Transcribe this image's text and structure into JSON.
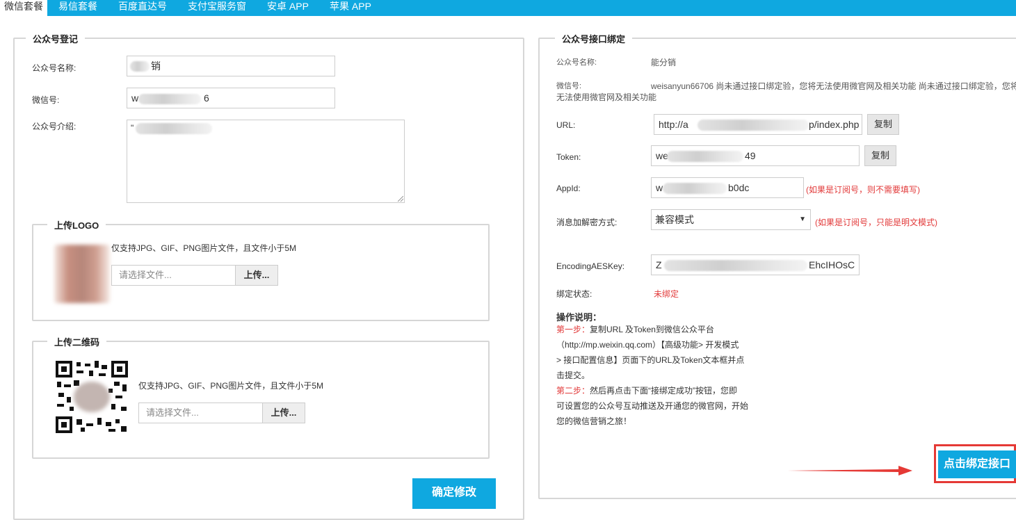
{
  "nav": {
    "tabs": [
      {
        "label": "微信套餐"
      },
      {
        "label": "易信套餐"
      },
      {
        "label": "百度直达号"
      },
      {
        "label": "支付宝服务窗"
      },
      {
        "label": "安卓 APP"
      },
      {
        "label": "苹果 APP"
      }
    ]
  },
  "left": {
    "legend": "公众号登记",
    "name_label": "公众号名称:",
    "name_value": "销",
    "wechat_label": "微信号:",
    "wechat_value_prefix": "w",
    "wechat_value_suffix": "6",
    "intro_label": "公众号介绍:",
    "intro_value": "\"",
    "logo": {
      "legend": "上传LOGO",
      "hint": "仅支持JPG、GIF、PNG图片文件，且文件小于5M",
      "placeholder": "请选择文件...",
      "button": "上传..."
    },
    "qr": {
      "legend": "上传二维码",
      "hint": "仅支持JPG、GIF、PNG图片文件，且文件小于5M",
      "placeholder": "请选择文件...",
      "button": "上传..."
    },
    "confirm_button": "确定修改"
  },
  "right": {
    "legend": "公众号接口绑定",
    "name_label": "公众号名称:",
    "name_value": "能分销",
    "wechat_label": "微信号:",
    "wechat_value_line1": "weisanyun66706 尚未通过接口绑定验，您将无法使用微官网及相关功能 尚未通过接口绑定验，您将",
    "wechat_value_line2": "无法使用微官网及相关功能",
    "url_label": "URL:",
    "url_prefix": "http://a",
    "url_suffix": "p/index.php",
    "copy_label": "复制",
    "token_label": "Token:",
    "token_prefix": "we",
    "token_suffix": "49",
    "appid_label": "AppId:",
    "appid_prefix": "w",
    "appid_suffix": "b0dc",
    "appid_hint": "(如果是订阅号，则不需要填写)",
    "encrypt_label": "消息加解密方式:",
    "encrypt_value": "兼容模式",
    "encrypt_hint": "(如果是订阅号，只能是明文模式)",
    "aes_label": "EncodingAESKey:",
    "aes_prefix": "Z",
    "aes_suffix": "EhcIHOsC",
    "status_label": "绑定状态:",
    "status_value": "未绑定",
    "instr_title": "操作说明：",
    "step1_tag": "第一步：",
    "step1_line1": "复制URL 及Token到微信公众平台",
    "step1_line2": "（http://mp.weixin.qq.com）【高级功能> 开发模式",
    "step1_line3": "> 接口配置信息】页面下的URL及Token文本框并点",
    "step1_line4": "击提交。",
    "step2_tag": "第二步：",
    "step2_line1": "然后再点击下面“接绑定成功”按钮，您即",
    "step2_line2": "可设置您的公众号互动推送及开通您的微官网，开始",
    "step2_line3": "您的微信营销之旅！",
    "bind_button": "点击绑定接口"
  },
  "colors": {
    "accent": "#0fa8e0",
    "warning": "#e23a3a",
    "annotation": "#e53935"
  }
}
